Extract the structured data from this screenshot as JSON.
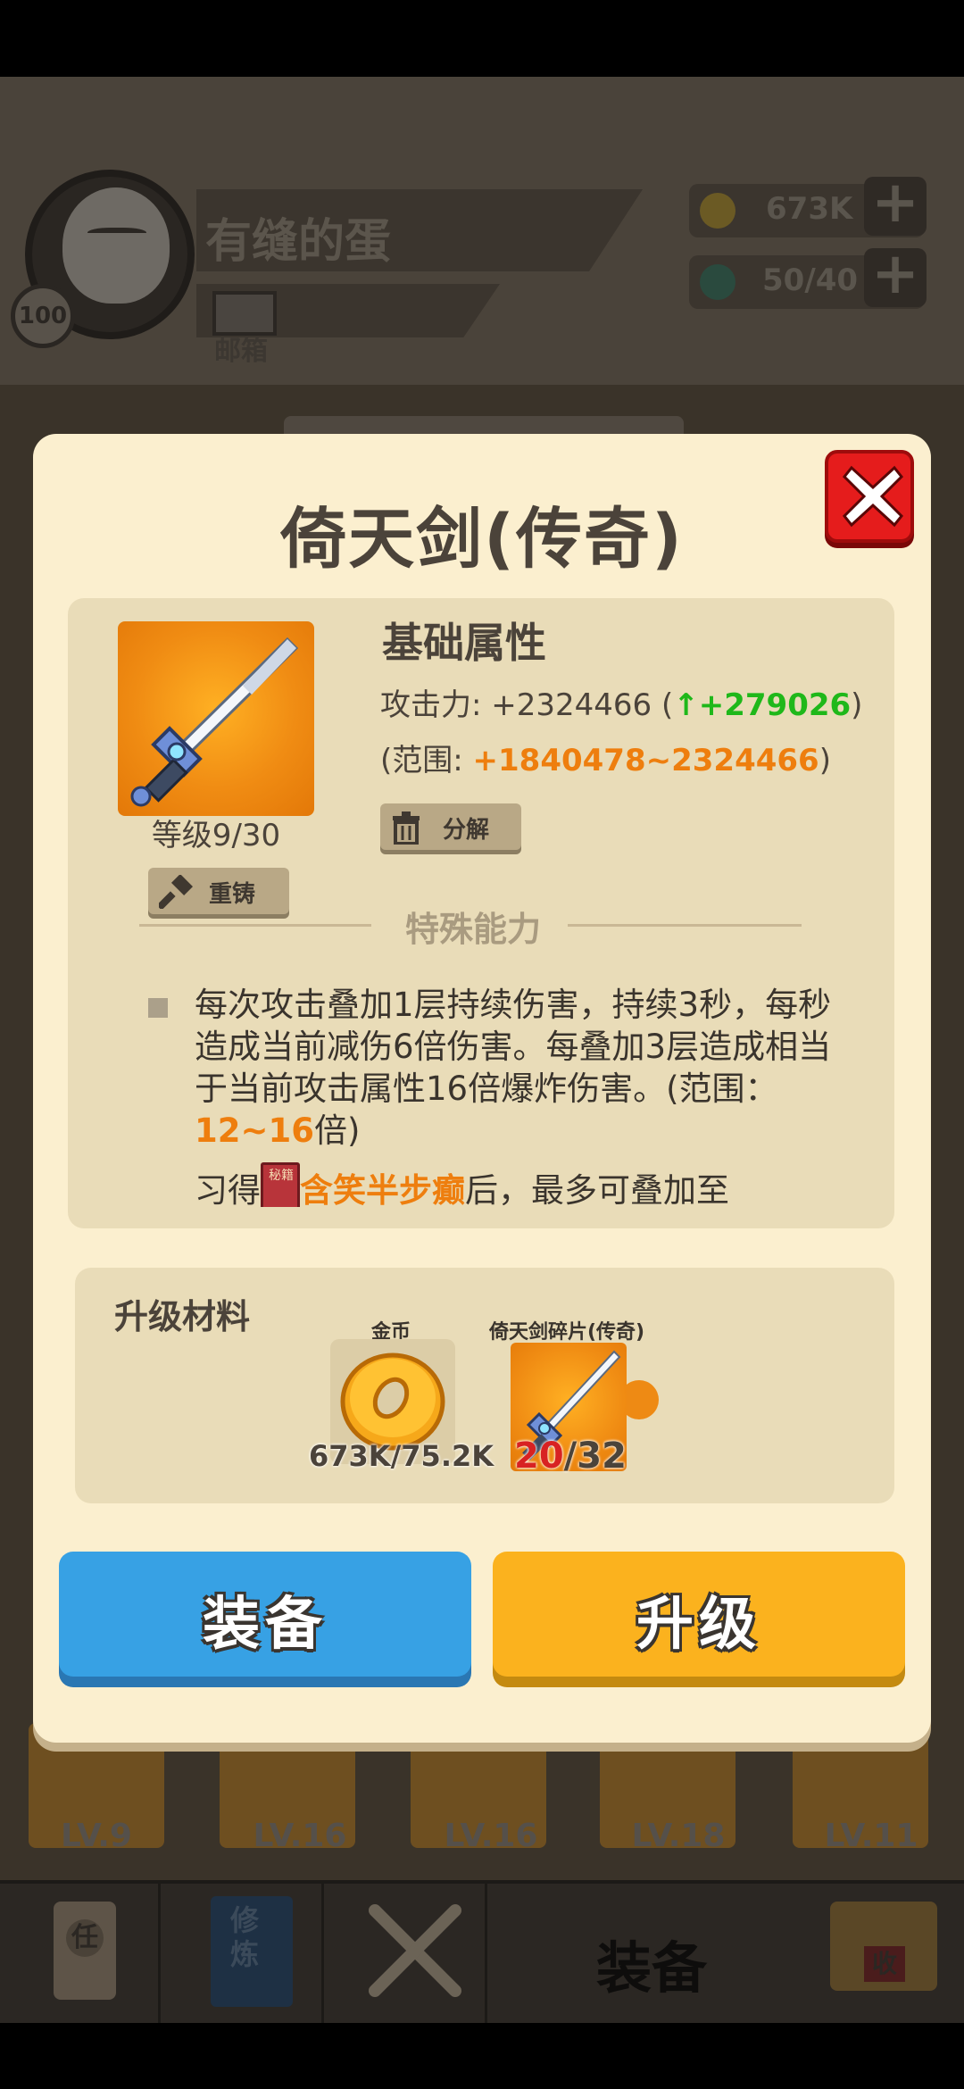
{
  "background": {
    "profile": {
      "name": "有缝的蛋",
      "level": "100",
      "mail_label": "邮箱"
    },
    "resources": {
      "gold": "673K",
      "energy": "50/40"
    },
    "equipment_slots": [
      "LV.9",
      "LV.16",
      "LV.16",
      "LV.18",
      "LV.11"
    ],
    "nav": {
      "task": "任",
      "cultivate": "修炼",
      "equip": "装备",
      "shop": "收"
    }
  },
  "dialog": {
    "title": "倚天剑(传奇)",
    "item_level": "等级9/30",
    "reforge_label": "重铸",
    "disassemble_label": "分解",
    "base_attributes": {
      "title": "基础属性",
      "attack_label": "攻击力: +2324466 (",
      "attack_delta": "↑+279026",
      "attack_close": ")",
      "range_label": "(范围: ",
      "range_value": "+1840478~2324466",
      "range_close": ")"
    },
    "special": {
      "title": "特殊能力",
      "desc_main": "每次攻击叠加1层持续伤害，持续3秒，每秒造成当前减伤6倍伤害。每叠加3层造成相当于当前攻击属性16倍爆炸伤害。(范围：",
      "desc_range": "12~16",
      "desc_end": "倍)",
      "learn_prefix": "习得",
      "book_label": "秘籍",
      "skill_name": "含笑半步癫",
      "learn_suffix": "后，最多可叠加至"
    },
    "materials": {
      "title": "升级材料",
      "gold_name": "金币",
      "gold_count": "673K/75.2K",
      "fragment_name": "倚天剑碎片(传奇)",
      "fragment_have": "20",
      "fragment_need": "/32"
    },
    "buttons": {
      "equip": "装备",
      "upgrade": "升级"
    }
  }
}
